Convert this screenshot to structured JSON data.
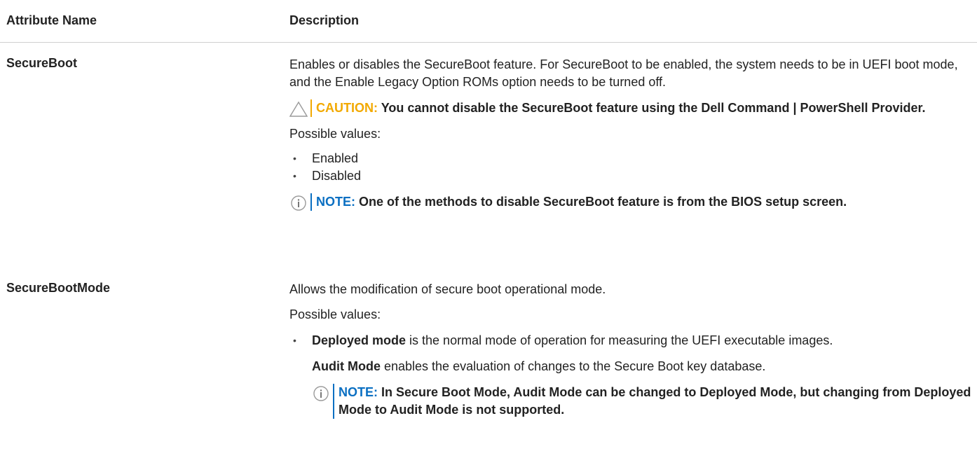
{
  "header": {
    "col_attribute": "Attribute Name",
    "col_description": "Description"
  },
  "rows": [
    {
      "name": "SecureBoot",
      "intro": "Enables or disables the SecureBoot feature. For SecureBoot to be enabled, the system needs to be in UEFI boot mode, and the Enable Legacy Option ROMs option needs to be turned off.",
      "caution_label": "CAUTION:",
      "caution_text": "You cannot disable the SecureBoot feature using the Dell Command | PowerShell Provider.",
      "possible_values_label": "Possible values:",
      "values": [
        "Enabled",
        "Disabled"
      ],
      "note_label": "NOTE:",
      "note_text": "One of the methods to disable SecureBoot feature is from the BIOS setup screen."
    },
    {
      "name": "SecureBootMode",
      "intro": "Allows the modification of secure boot operational mode.",
      "possible_values_label": "Possible values:",
      "deployed_term": "Deployed mode",
      "deployed_text": " is the normal mode of operation for measuring the UEFI executable images.",
      "audit_term": "Audit Mode",
      "audit_text": " enables the evaluation of changes to the Secure Boot key database.",
      "note_label": "NOTE:",
      "note_text": "In Secure Boot Mode, Audit Mode can be changed to Deployed Mode, but changing from Deployed Mode to Audit Mode is not supported."
    }
  ],
  "bullet_glyph": "•",
  "colors": {
    "caution": "#f2a900",
    "note": "#0a6fc2",
    "divider": "#cfcfcf"
  },
  "icons": {
    "caution": "warning-triangle-icon",
    "note": "info-circle-icon"
  }
}
